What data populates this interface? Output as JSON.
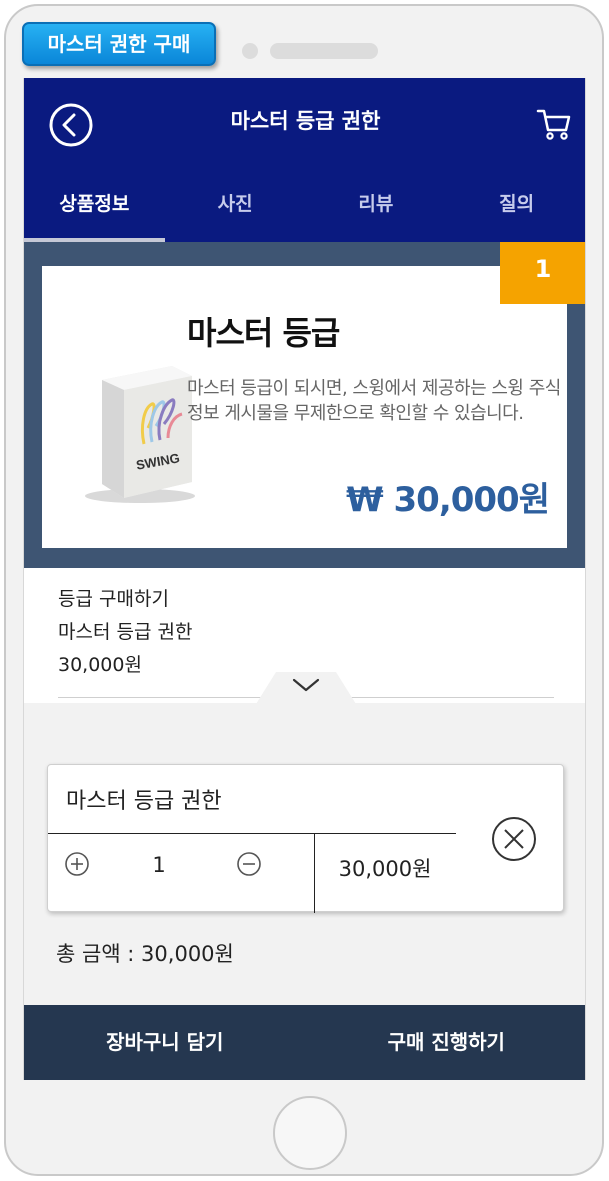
{
  "page_tag": "마스터 권한 구매",
  "header": {
    "title": "마스터 등급 권한",
    "back_icon": "back-circle-icon",
    "cart_icon": "cart-icon"
  },
  "tabs": [
    {
      "label": "상품정보",
      "active": true
    },
    {
      "label": "사진",
      "active": false
    },
    {
      "label": "리뷰",
      "active": false
    },
    {
      "label": "질의",
      "active": false
    }
  ],
  "product": {
    "rank": "1",
    "title": "마스터 등급",
    "description": "마스터 등급이 되시면, 스윙에서 제공하는 스윙 주식 정보 게시물을 무제한으로 확인할 수 있습니다.",
    "price": "₩ 30,000원",
    "box_logo_text": "SWING"
  },
  "summary": {
    "heading": "등급 구매하기",
    "item": "마스터 등급 권한",
    "price": "30,000원"
  },
  "option": {
    "name": "마스터 등급 권한",
    "quantity": "1",
    "price": "30,000원",
    "plus_icon": "plus-circle-icon",
    "minus_icon": "minus-circle-icon",
    "remove_icon": "close-circle-icon"
  },
  "total": "총 금액 : 30,000원",
  "actions": {
    "cart_label": "장바구니 담기",
    "buy_label": "구매 진행하기"
  },
  "colors": {
    "header_bg": "#0a1a80",
    "banner_bg": "#3e5573",
    "badge_bg": "#f5a300",
    "price_text": "#2d5f9e",
    "action_bar_bg": "#253750",
    "page_tag_bg": "#1a9be6"
  }
}
